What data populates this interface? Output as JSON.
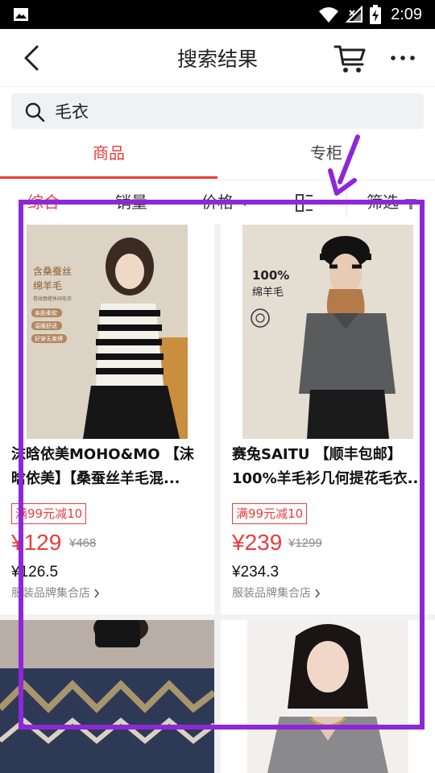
{
  "status_bar": {
    "time": "2:09"
  },
  "header": {
    "title": "搜索结果"
  },
  "search": {
    "value": "毛衣"
  },
  "main_tabs": [
    {
      "label": "商品",
      "active": true
    },
    {
      "label": "专柜",
      "active": false
    }
  ],
  "sort_bar": {
    "items": [
      "综合",
      "销量",
      "价格"
    ],
    "filter_label": "筛选"
  },
  "products": [
    {
      "name": "沫晗依美MOHO&MO 【沫晗依美】【桑蚕丝羊毛混...",
      "promo": "满99元减10",
      "price": "¥129",
      "original_price": "¥468",
      "vip_price": "¥126.5",
      "shop": "服装品牌集合店",
      "image_text": [
        "含桑蚕丝",
        "绵羊毛",
        "卷纹廓搭休闲毛衣",
        "亲肤柔软",
        "温暖舒适",
        "好穿无束缚"
      ]
    },
    {
      "name": "赛兔SAITU 【顺丰包邮】100%羊毛衫几何提花毛衣...",
      "promo": "满99元减10",
      "price": "¥239",
      "original_price": "¥1299",
      "vip_price": "¥234.3",
      "shop": "服装品牌集合店",
      "image_text": [
        "100%",
        "绵羊毛"
      ]
    },
    {
      "name": "",
      "promo": "",
      "price": "",
      "original_price": "",
      "vip_price": "",
      "shop": ""
    },
    {
      "name": "",
      "promo": "",
      "price": "",
      "original_price": "",
      "vip_price": "",
      "shop": ""
    }
  ],
  "colors": {
    "accent": "#e83e3e",
    "annotation": "#8e27d8"
  }
}
